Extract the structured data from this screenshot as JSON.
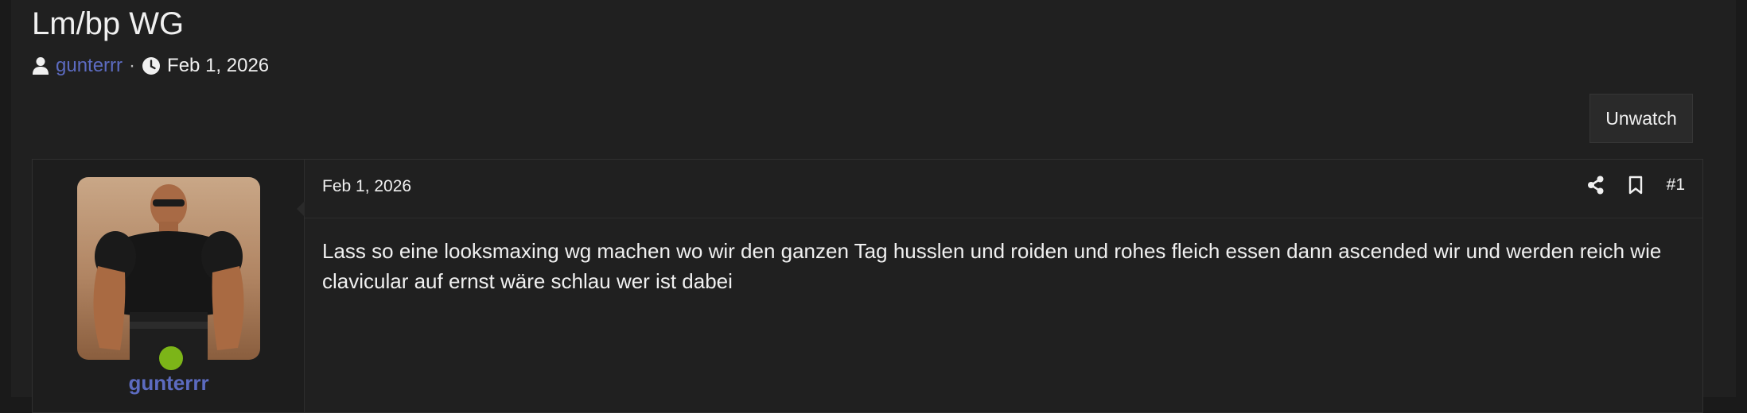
{
  "thread": {
    "title": "Lm/bp WG",
    "author": "gunterrr",
    "separator": "·",
    "date": "Feb 1, 2026",
    "watch_label": "Unwatch"
  },
  "post": {
    "date": "Feb 1, 2026",
    "number": "#1",
    "username": "gunterrr",
    "body": "Lass so eine looksmaxing wg machen wo wir den ganzen Tag husslen und roiden und rohes fleich essen dann ascended wir und werden reich wie clavicular auf ernst wäre schlau wer ist dabei",
    "user_online": true
  },
  "icons": {
    "author": "user-icon",
    "date": "clock-icon",
    "share": "share-icon",
    "bookmark": "bookmark-icon"
  },
  "colors": {
    "background": "#202020",
    "link": "#5c6bc0",
    "online": "#7cb518"
  }
}
